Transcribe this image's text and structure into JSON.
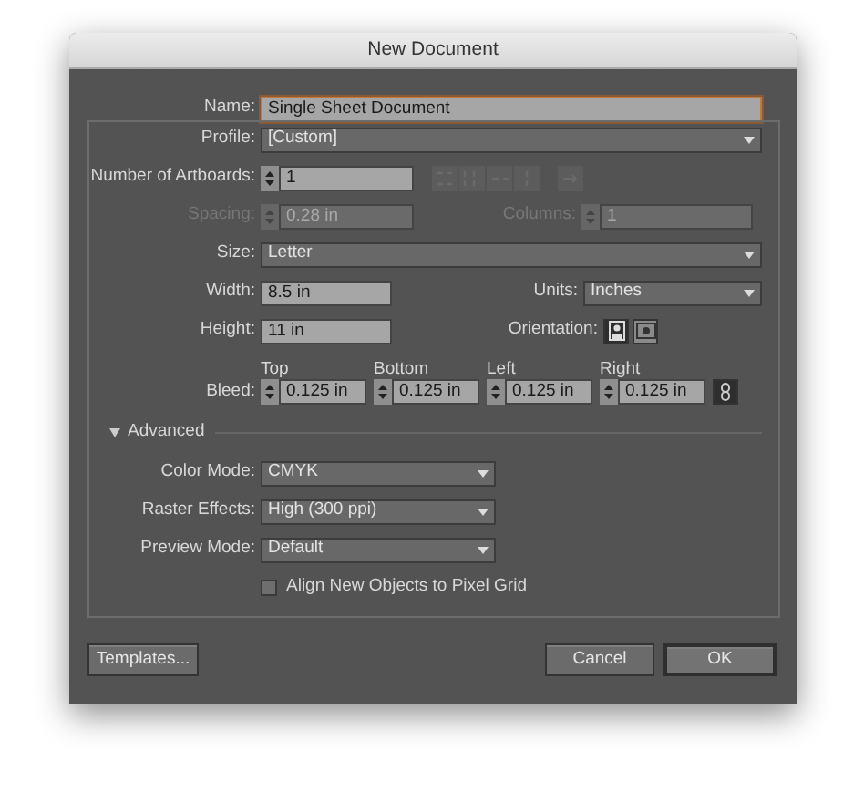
{
  "window": {
    "title": "New Document"
  },
  "name": {
    "label": "Name:",
    "value": "Single Sheet Document",
    "focused": true
  },
  "profile": {
    "label": "Profile:",
    "value": "[Custom]"
  },
  "artboards": {
    "label": "Number of Artboards:",
    "value": "1",
    "layout_disabled": true
  },
  "spacing": {
    "label": "Spacing:",
    "value": "0.28 in",
    "disabled": true
  },
  "columns": {
    "label": "Columns:",
    "value": "1",
    "disabled": true
  },
  "size": {
    "label": "Size:",
    "value": "Letter"
  },
  "width": {
    "label": "Width:",
    "value": "8.5 in"
  },
  "units": {
    "label": "Units:",
    "value": "Inches"
  },
  "height": {
    "label": "Height:",
    "value": "11 in"
  },
  "orientation": {
    "label": "Orientation:",
    "options": [
      {
        "kind": "portrait",
        "selected": true
      },
      {
        "kind": "landscape",
        "selected": false
      }
    ]
  },
  "bleed": {
    "label": "Bleed:",
    "fields": [
      {
        "label": "Top",
        "value": "0.125 in"
      },
      {
        "label": "Bottom",
        "value": "0.125 in"
      },
      {
        "label": "Left",
        "value": "0.125 in"
      },
      {
        "label": "Right",
        "value": "0.125 in"
      }
    ]
  },
  "advanced": {
    "label": "Advanced",
    "expanded": true,
    "selects": [
      {
        "label": "Color Mode:",
        "value": "CMYK"
      },
      {
        "label": "Raster Effects:",
        "value": "High (300 ppi)"
      },
      {
        "label": "Preview Mode:",
        "value": "Default"
      }
    ],
    "checkbox": {
      "label": "Align New Objects to Pixel Grid",
      "checked": false
    }
  },
  "buttons": [
    {
      "label": "Templates...",
      "kind": "left",
      "default": false
    },
    {
      "label": "Cancel",
      "kind": "right",
      "default": false
    },
    {
      "label": "OK",
      "kind": "right",
      "default": true
    }
  ]
}
